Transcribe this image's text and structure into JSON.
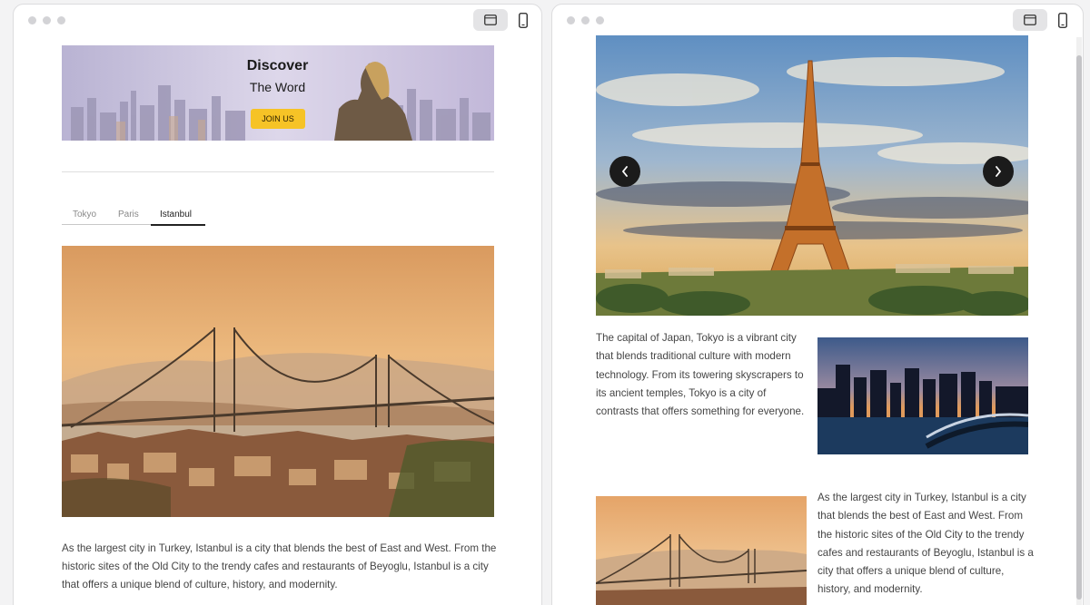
{
  "left_window": {
    "banner": {
      "title": "Discover",
      "subtitle": "The Word",
      "button_label": "JOIN US"
    },
    "tabs": [
      {
        "label": "Tokyo",
        "active": false
      },
      {
        "label": "Paris",
        "active": false
      },
      {
        "label": "Istanbul",
        "active": true
      }
    ],
    "paragraph": "As the largest city in Turkey, Istanbul is a city that blends the best of East and West. From the historic sites of the Old City to the trendy cafes and restaurants of Beyoglu, Istanbul is a city that offers a unique blend of culture, history, and modernity."
  },
  "right_window": {
    "carousel": {
      "prev_icon": "chevron-left-icon",
      "next_icon": "chevron-right-icon"
    },
    "tokyo_paragraph": "The capital of Japan, Tokyo is a vibrant city that blends traditional culture with modern technology. From its towering skyscrapers to its ancient temples, Tokyo is a city of contrasts that offers something for everyone.",
    "istanbul_paragraph": "As the largest city in Turkey, Istanbul is a city that blends the best of East and West. From the historic sites of the Old City to the trendy cafes and restaurants of Beyoglu, Istanbul is a city that offers a unique blend of culture, history, and modernity."
  },
  "toolbar": {
    "desktop_icon": "desktop-view-icon",
    "mobile_icon": "mobile-view-icon"
  },
  "colors": {
    "accent_button": "#f6c326",
    "tab_active": "#222222",
    "carousel_arrow": "#1b1b1b"
  }
}
